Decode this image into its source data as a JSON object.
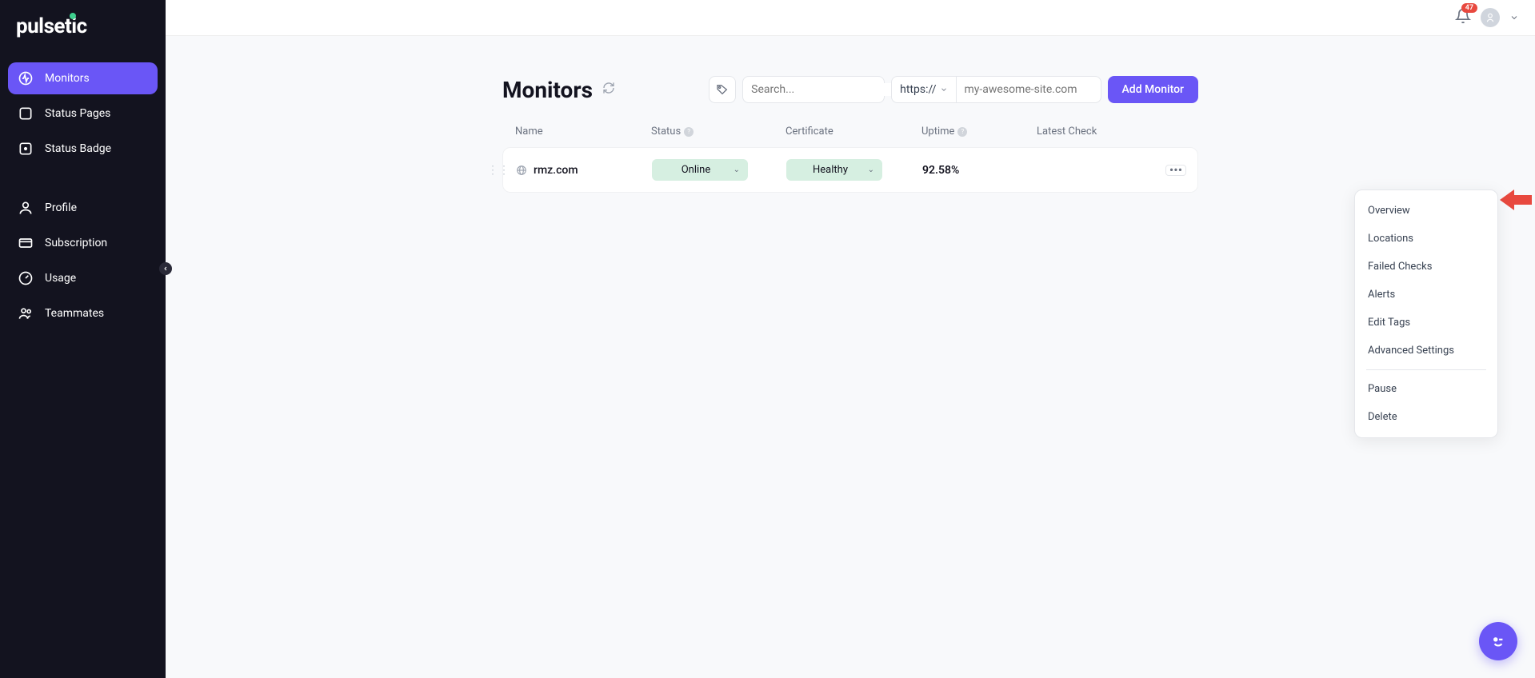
{
  "brand": "pulsetic",
  "nav": {
    "monitors": "Monitors",
    "status_pages": "Status Pages",
    "status_badge": "Status Badge",
    "profile": "Profile",
    "subscription": "Subscription",
    "usage": "Usage",
    "teammates": "Teammates"
  },
  "notifications": {
    "count": "47"
  },
  "page": {
    "title": "Monitors",
    "search_placeholder": "Search...",
    "protocol": "https://",
    "url_placeholder": "my-awesome-site.com",
    "add_button": "Add Monitor"
  },
  "columns": {
    "name": "Name",
    "status": "Status",
    "certificate": "Certificate",
    "uptime": "Uptime",
    "latest_check": "Latest Check"
  },
  "row": {
    "name": "rmz.com",
    "status": "Online",
    "certificate": "Healthy",
    "uptime": "92.58%"
  },
  "menu": {
    "overview": "Overview",
    "locations": "Locations",
    "failed_checks": "Failed Checks",
    "alerts": "Alerts",
    "edit_tags": "Edit Tags",
    "advanced_settings": "Advanced Settings",
    "pause": "Pause",
    "delete": "Delete"
  }
}
